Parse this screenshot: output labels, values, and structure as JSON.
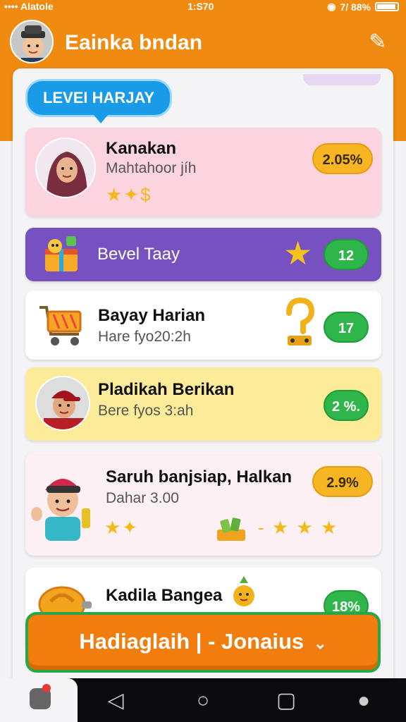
{
  "status_bar": {
    "carrier": "•••• Alatole",
    "time": "1:S70",
    "battery": "7/ 88%"
  },
  "header": {
    "title": "Eainka bndan"
  },
  "level_badge": {
    "label": "LEVEI HARJAY"
  },
  "cards": [
    {
      "title": "Kanakan",
      "subtitle": "Mahtahoor jíh",
      "badge": "2.05%",
      "badge_color": "#f7b524",
      "icons": "★✦$"
    },
    {
      "title": "Bevel Taay",
      "badge": "12",
      "badge_color": "#2fb64a",
      "icon": "★"
    },
    {
      "title": "Bayay Harian",
      "subtitle": "Hare fyo20:2h",
      "badge": "17",
      "badge_color": "#2fb64a"
    },
    {
      "title": "Pladikah Berikan",
      "subtitle": "Bere fyos 3:ah",
      "badge": "2 %.",
      "badge_color": "#2fb64a"
    },
    {
      "title": "Saruh banjsiap, Halkan",
      "subtitle": "Dahar 3.00",
      "badge": "2.9%",
      "badge_color": "#f7b524",
      "stars_left": "★✦",
      "stars_right": "-  ★ ★ ★"
    },
    {
      "title": "Kadila Bangea",
      "badge": "18%",
      "badge_color": "#2fb64a"
    }
  ],
  "cta": {
    "label": "Hadiaglaih | - Jonaius"
  },
  "colors": {
    "brand": "#f08a10",
    "accent_blue": "#1a9be8",
    "success_green": "#2fb64a"
  }
}
